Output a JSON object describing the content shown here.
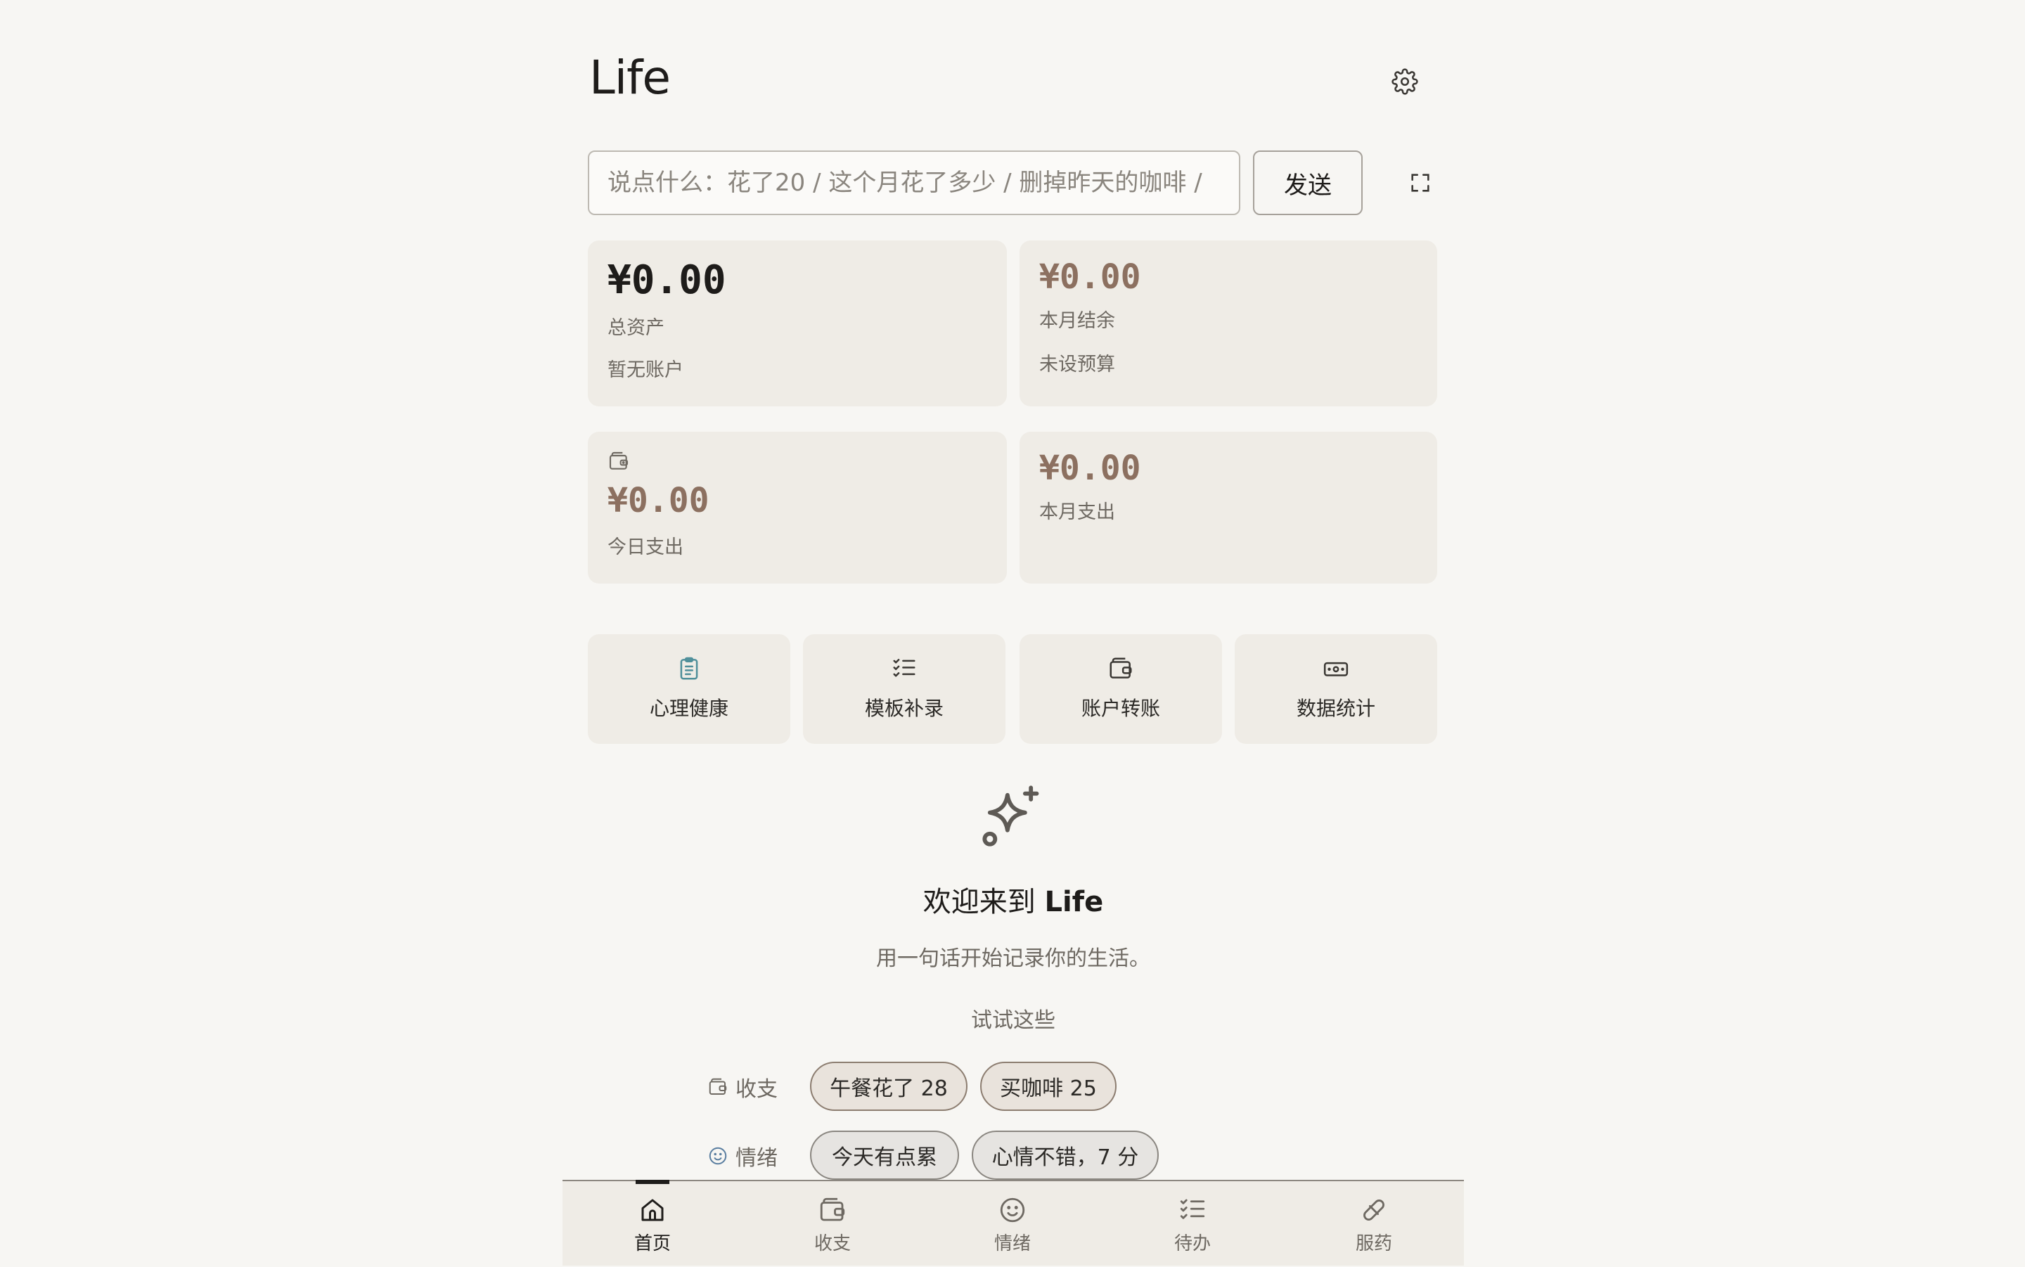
{
  "app": {
    "title": "Life"
  },
  "input": {
    "placeholder": "说点什么：花了20 / 这个月花了多少 / 删掉昨天的咖啡 /",
    "value": "",
    "send_label": "发送"
  },
  "cards": {
    "total_assets": {
      "amount": "¥0.00",
      "label": "总资产",
      "sub": "暂无账户"
    },
    "month_balance": {
      "amount": "¥0.00",
      "label": "本月结余",
      "sub": "未设预算"
    },
    "today_expense": {
      "amount": "¥0.00",
      "label": "今日支出"
    },
    "month_expense": {
      "amount": "¥0.00",
      "label": "本月支出"
    }
  },
  "quick_actions": [
    {
      "label": "心理健康",
      "icon": "clipboard-icon",
      "color": "#4f8f9a"
    },
    {
      "label": "模板补录",
      "icon": "checklist-icon"
    },
    {
      "label": "账户转账",
      "icon": "wallet-icon"
    },
    {
      "label": "数据统计",
      "icon": "money-icon"
    }
  ],
  "welcome": {
    "title_prefix": "欢迎来到",
    "title_brand": "Life",
    "subtitle": "用一句话开始记录你的生活。",
    "try_label": "试试这些"
  },
  "suggestions": [
    {
      "category": "收支",
      "icon": "wallet-icon",
      "chips": [
        "午餐花了 28",
        "买咖啡 25"
      ]
    },
    {
      "category": "情绪",
      "icon": "smile-icon",
      "chips": [
        "今天有点累",
        "心情不错，7 分"
      ]
    }
  ],
  "tabs": [
    {
      "label": "首页",
      "icon": "home-icon",
      "active": true
    },
    {
      "label": "收支",
      "icon": "wallet-icon"
    },
    {
      "label": "情绪",
      "icon": "smile-icon"
    },
    {
      "label": "待办",
      "icon": "checklist-icon"
    },
    {
      "label": "服药",
      "icon": "pill-icon"
    }
  ],
  "colors": {
    "background": "#f7f6f3",
    "card": "#efece6",
    "amount_accent": "#8c7060",
    "text_primary": "#1e1c1a",
    "text_secondary": "#6e6962"
  }
}
